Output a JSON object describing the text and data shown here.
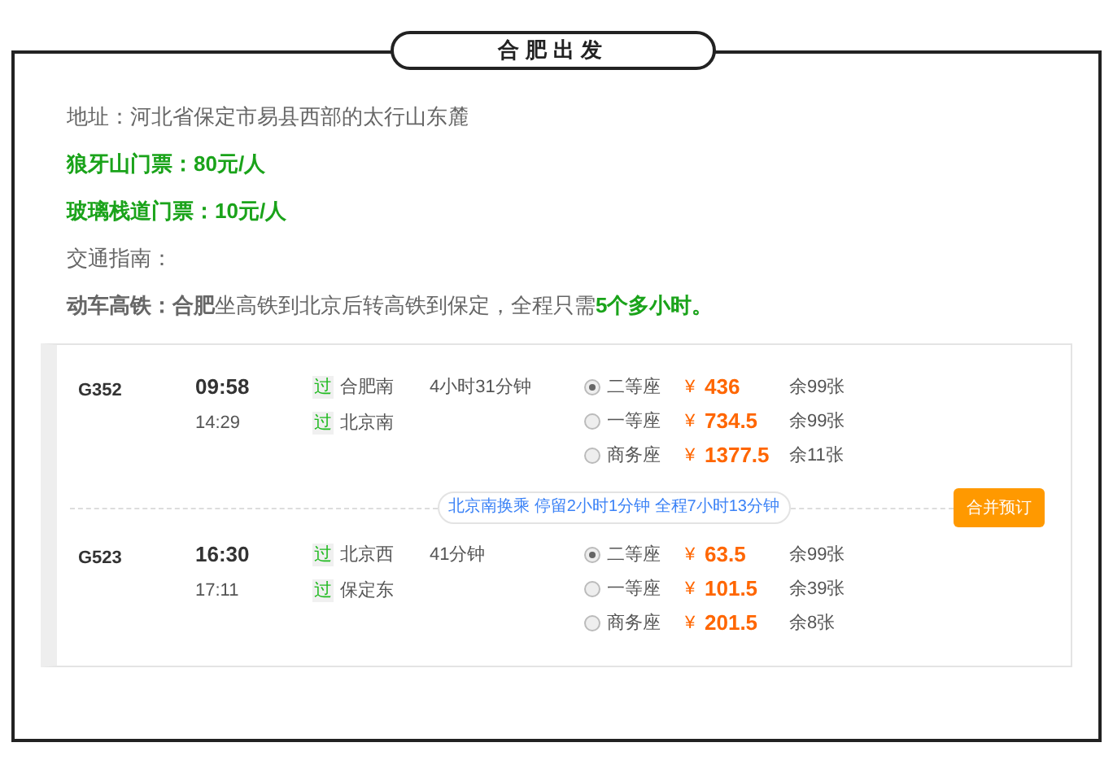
{
  "title": "合肥出发",
  "address": "地址：河北省保定市易县西部的太行山东麓",
  "tickets": [
    "狼牙山门票：80元/人",
    "玻璃栈道门票：10元/人"
  ],
  "guide_label": "交通指南：",
  "transport": {
    "lead": "动车高铁：合肥",
    "text": "坐高铁到北京后转高铁到保定，全程只需",
    "highlight": "5个多小时。"
  },
  "trains": [
    {
      "number": "G352",
      "depart": "09:58",
      "arrive": "14:29",
      "stops": [
        {
          "badge": "过",
          "name": "合肥南"
        },
        {
          "badge": "过",
          "name": "北京南"
        }
      ],
      "duration": "4小时31分钟",
      "seats": [
        {
          "name": "二等座",
          "currency": "¥",
          "price": "436",
          "remaining": "余99张",
          "selected": true
        },
        {
          "name": "一等座",
          "currency": "¥",
          "price": "734.5",
          "remaining": "余99张",
          "selected": false
        },
        {
          "name": "商务座",
          "currency": "¥",
          "price": "1377.5",
          "remaining": "余11张",
          "selected": false
        }
      ]
    },
    {
      "number": "G523",
      "depart": "16:30",
      "arrive": "17:11",
      "stops": [
        {
          "badge": "过",
          "name": "北京西"
        },
        {
          "badge": "过",
          "name": "保定东"
        }
      ],
      "duration": "41分钟",
      "seats": [
        {
          "name": "二等座",
          "currency": "¥",
          "price": "63.5",
          "remaining": "余99张",
          "selected": true
        },
        {
          "name": "一等座",
          "currency": "¥",
          "price": "101.5",
          "remaining": "余39张",
          "selected": false
        },
        {
          "name": "商务座",
          "currency": "¥",
          "price": "201.5",
          "remaining": "余8张",
          "selected": false
        }
      ]
    }
  ],
  "transfer": "北京南换乘 停留2小时1分钟 全程7小时13分钟",
  "book_button": "合并预订"
}
